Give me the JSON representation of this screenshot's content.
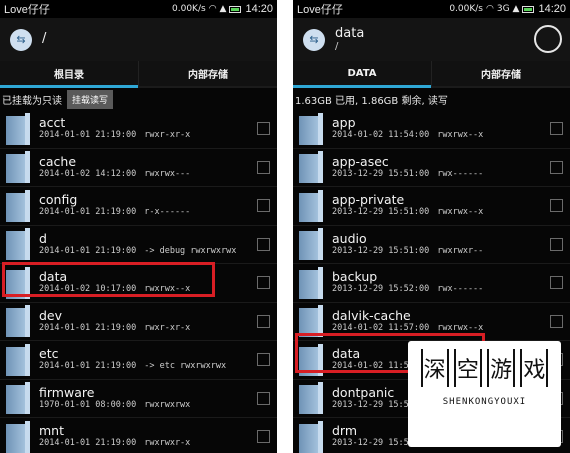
{
  "left": {
    "status": {
      "carrier": "Love仔仔",
      "speed": "0.00K/s",
      "time": "14:20"
    },
    "title": {
      "path": "/"
    },
    "tabs": [
      {
        "label": "根目录",
        "active": true
      },
      {
        "label": "内部存储",
        "active": false
      }
    ],
    "info": {
      "text": "已挂载为只读",
      "button": "挂载读写"
    },
    "files": [
      {
        "name": "acct",
        "date": "2014-01-01 21:19:00",
        "perm": "rwxr-xr-x"
      },
      {
        "name": "cache",
        "date": "2014-01-02 14:12:00",
        "perm": "rwxrwx---"
      },
      {
        "name": "config",
        "date": "2014-01-01 21:19:00",
        "perm": "r-x------"
      },
      {
        "name": "d",
        "date": "2014-01-01 21:19:00",
        "perm": "-> debug rwxrwxrwx"
      },
      {
        "name": "data",
        "date": "2014-01-02 10:17:00",
        "perm": "rwxrwx--x"
      },
      {
        "name": "dev",
        "date": "2014-01-01 21:19:00",
        "perm": "rwxr-xr-x"
      },
      {
        "name": "etc",
        "date": "2014-01-01 21:19:00",
        "perm": "-> etc rwxrwxrwx"
      },
      {
        "name": "firmware",
        "date": "1970-01-01 08:00:00",
        "perm": "rwxrwxrwx"
      },
      {
        "name": "mnt",
        "date": "2014-01-01 21:19:00",
        "perm": "rwxrwxr-x"
      }
    ]
  },
  "right": {
    "status": {
      "carrier": "Love仔仔",
      "speed": "0.00K/s",
      "network": "3G",
      "time": "14:20"
    },
    "title": {
      "path": "data",
      "subpath": "/"
    },
    "tabs": [
      {
        "label": "DATA",
        "active": true
      },
      {
        "label": "内部存储",
        "active": false
      }
    ],
    "info": {
      "text": "1.63GB 已用, 1.86GB 剩余, 读写"
    },
    "files": [
      {
        "name": "app",
        "date": "2014-01-02 11:54:00",
        "perm": "rwxrwx--x"
      },
      {
        "name": "app-asec",
        "date": "2013-12-29 15:51:00",
        "perm": "rwx------"
      },
      {
        "name": "app-private",
        "date": "2013-12-29 15:51:00",
        "perm": "rwxrwx--x"
      },
      {
        "name": "audio",
        "date": "2013-12-29 15:51:00",
        "perm": "rwxrwxr--"
      },
      {
        "name": "backup",
        "date": "2013-12-29 15:52:00",
        "perm": "rwx------"
      },
      {
        "name": "dalvik-cache",
        "date": "2014-01-02 11:57:00",
        "perm": "rwxrwx--x"
      },
      {
        "name": "data",
        "date": "2014-01-02 11:54:00",
        "perm": ""
      },
      {
        "name": "dontpanic",
        "date": "2013-12-29 15:51:00",
        "perm": ""
      },
      {
        "name": "drm",
        "date": "2013-12-29 15:52:00",
        "perm": ""
      }
    ]
  },
  "watermark": {
    "chars": [
      "深",
      "空",
      "游",
      "戏"
    ],
    "text": "SHENKONGYOUXI"
  },
  "colors": {
    "accent": "#2fa8d6",
    "highlight": "#d81e24",
    "background": "#060606"
  }
}
